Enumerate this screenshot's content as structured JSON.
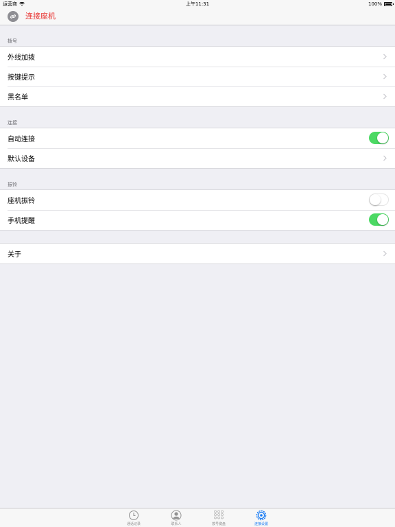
{
  "status_bar": {
    "carrier": "运营商",
    "time": "上午11:31",
    "battery": "100%"
  },
  "nav": {
    "title": "连接座机"
  },
  "sections": {
    "dial": {
      "header": "拨号",
      "items": [
        "外线加拨",
        "按键提示",
        "黑名单"
      ]
    },
    "connect": {
      "header": "连接",
      "auto_connect": {
        "label": "自动连接",
        "on": true
      },
      "default_device": "默认设备"
    },
    "ring": {
      "header": "振铃",
      "desk_ring": {
        "label": "座机振铃",
        "on": false
      },
      "phone_alert": {
        "label": "手机提醒",
        "on": true
      }
    },
    "about": {
      "label": "关于"
    }
  },
  "tabs": [
    {
      "label": "通话记录",
      "icon": "clock-icon",
      "active": false
    },
    {
      "label": "联系人",
      "icon": "contact-icon",
      "active": false
    },
    {
      "label": "拨号键盘",
      "icon": "keypad-icon",
      "active": false
    },
    {
      "label": "连接设置",
      "icon": "gear-icon",
      "active": true
    }
  ],
  "colors": {
    "accent_red": "#e8322f",
    "switch_on": "#4cd964",
    "tab_active": "#1a7cf4",
    "background": "#efeff4"
  }
}
